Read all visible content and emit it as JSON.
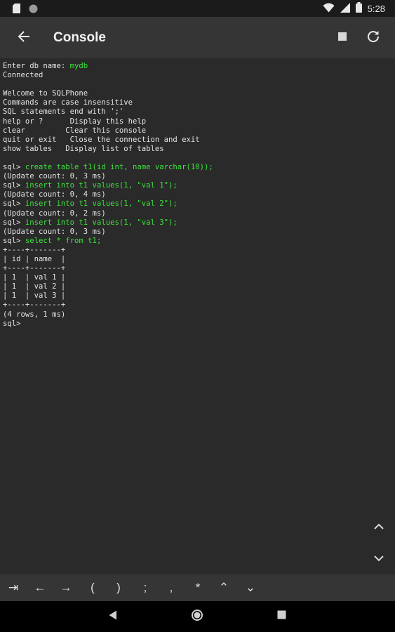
{
  "status_bar": {
    "time": "5:28",
    "icons": [
      "sd-card-icon",
      "circle-notification-icon",
      "wifi-icon",
      "signal-icon",
      "battery-icon"
    ]
  },
  "app_bar": {
    "title": "Console",
    "icons": [
      "back-arrow-icon",
      "stop-icon",
      "refresh-icon"
    ]
  },
  "console": {
    "lines": [
      {
        "segments": [
          {
            "text": "Enter db name: ",
            "color": "normal"
          },
          {
            "text": "mydb",
            "color": "green"
          }
        ]
      },
      {
        "segments": [
          {
            "text": "Connected",
            "color": "normal"
          }
        ]
      },
      {
        "segments": [
          {
            "text": "",
            "color": "normal"
          }
        ]
      },
      {
        "segments": [
          {
            "text": "Welcome to SQLPhone",
            "color": "normal"
          }
        ]
      },
      {
        "segments": [
          {
            "text": "Commands are case insensitive",
            "color": "normal"
          }
        ]
      },
      {
        "segments": [
          {
            "text": "SQL statements end with ';'",
            "color": "normal"
          }
        ]
      },
      {
        "segments": [
          {
            "text": "help or ?      Display this help",
            "color": "normal"
          }
        ]
      },
      {
        "segments": [
          {
            "text": "clear         Clear this console",
            "color": "normal"
          }
        ]
      },
      {
        "segments": [
          {
            "text": "quit or exit   Close the connection and exit",
            "color": "normal"
          }
        ]
      },
      {
        "segments": [
          {
            "text": "show tables   Display list of tables",
            "color": "normal"
          }
        ]
      },
      {
        "segments": [
          {
            "text": "",
            "color": "normal"
          }
        ]
      },
      {
        "segments": [
          {
            "text": "sql> ",
            "color": "normal"
          },
          {
            "text": "create table t1(id int, name varchar(10));",
            "color": "green"
          }
        ]
      },
      {
        "segments": [
          {
            "text": "(Update count: 0, 3 ms)",
            "color": "normal"
          }
        ]
      },
      {
        "segments": [
          {
            "text": "sql> ",
            "color": "normal"
          },
          {
            "text": "insert into t1 values(1, \"val 1\");",
            "color": "green"
          }
        ]
      },
      {
        "segments": [
          {
            "text": "(Update count: 0, 4 ms)",
            "color": "normal"
          }
        ]
      },
      {
        "segments": [
          {
            "text": "sql> ",
            "color": "normal"
          },
          {
            "text": "insert into t1 values(1, \"val 2\");",
            "color": "green"
          }
        ]
      },
      {
        "segments": [
          {
            "text": "(Update count: 0, 2 ms)",
            "color": "normal"
          }
        ]
      },
      {
        "segments": [
          {
            "text": "sql> ",
            "color": "normal"
          },
          {
            "text": "insert into t1 values(1, \"val 3\");",
            "color": "green"
          }
        ]
      },
      {
        "segments": [
          {
            "text": "(Update count: 0, 3 ms)",
            "color": "normal"
          }
        ]
      },
      {
        "segments": [
          {
            "text": "sql> ",
            "color": "normal"
          },
          {
            "text": "select * from t1;",
            "color": "green"
          }
        ]
      },
      {
        "segments": [
          {
            "text": "+----+-------+",
            "color": "normal"
          }
        ]
      },
      {
        "segments": [
          {
            "text": "| id | name  |",
            "color": "normal"
          }
        ]
      },
      {
        "segments": [
          {
            "text": "+----+-------+",
            "color": "normal"
          }
        ]
      },
      {
        "segments": [
          {
            "text": "| 1  | val 1 |",
            "color": "normal"
          }
        ]
      },
      {
        "segments": [
          {
            "text": "| 1  | val 2 |",
            "color": "normal"
          }
        ]
      },
      {
        "segments": [
          {
            "text": "| 1  | val 3 |",
            "color": "normal"
          }
        ]
      },
      {
        "segments": [
          {
            "text": "+----+-------+",
            "color": "normal"
          }
        ]
      },
      {
        "segments": [
          {
            "text": "(4 rows, 1 ms)",
            "color": "normal"
          }
        ]
      },
      {
        "segments": [
          {
            "text": "sql>",
            "color": "normal"
          }
        ]
      }
    ],
    "scroll_icons": [
      "chevron-up-icon",
      "chevron-down-icon"
    ]
  },
  "key_bar": {
    "keys": [
      {
        "name": "tab-key",
        "label": "⇥"
      },
      {
        "name": "left-arrow-key",
        "label": "←"
      },
      {
        "name": "right-arrow-key",
        "label": "→"
      },
      {
        "name": "open-paren-key",
        "label": "("
      },
      {
        "name": "close-paren-key",
        "label": ")"
      },
      {
        "name": "semicolon-key",
        "label": ";"
      },
      {
        "name": "comma-key",
        "label": ","
      },
      {
        "name": "asterisk-key",
        "label": "*"
      },
      {
        "name": "history-up-key",
        "label": "⌃"
      },
      {
        "name": "history-down-key",
        "label": "⌄"
      }
    ]
  },
  "nav_bar": {
    "icons": [
      "back-triangle-icon",
      "home-circle-icon",
      "recents-square-icon"
    ]
  },
  "colors": {
    "background": "#2a2a2a",
    "app_bar": "#353535",
    "command_green": "#3be33b",
    "text": "#e4e4e4"
  }
}
